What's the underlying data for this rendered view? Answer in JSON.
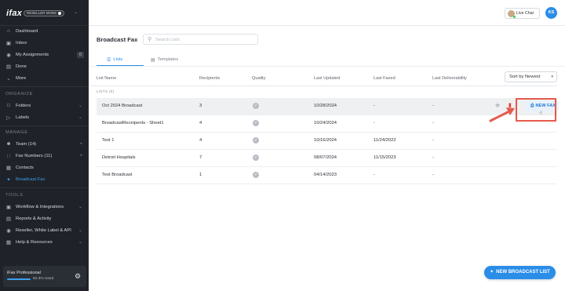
{
  "brand": {
    "logo": "ifax",
    "reseller_label": "RESELLER MODE"
  },
  "sidebar": {
    "primary": [
      {
        "label": "Dashboard",
        "icon": "home-icon"
      },
      {
        "label": "Inbox",
        "icon": "inbox-icon"
      },
      {
        "label": "My Assignments",
        "icon": "assignment-icon",
        "badge": "0"
      },
      {
        "label": "Done",
        "icon": "done-icon"
      },
      {
        "label": "More",
        "icon": "chevron-down-icon"
      }
    ],
    "organize_title": "ORGANIZE",
    "organize": [
      {
        "label": "Folders",
        "icon": "folder-icon"
      },
      {
        "label": "Labels",
        "icon": "label-icon"
      }
    ],
    "manage_title": "MANAGE",
    "manage": [
      {
        "label": "Team (14)",
        "icon": "team-icon"
      },
      {
        "label": "Fax Numbers (11)",
        "icon": "fax-number-icon"
      },
      {
        "label": "Contacts",
        "icon": "contacts-icon"
      },
      {
        "label": "Broadcast Fax",
        "icon": "broadcast-icon",
        "active": true
      }
    ],
    "tools_title": "TOOLS",
    "tools": [
      {
        "label": "Workflow & Integrations",
        "icon": "workflow-icon"
      },
      {
        "label": "Reports & Activity",
        "icon": "reports-icon"
      },
      {
        "label": "Reseller, White Label & API",
        "icon": "globe-icon"
      },
      {
        "label": "Help & Resources",
        "icon": "help-icon"
      }
    ],
    "plan": {
      "name": "iFax Professional",
      "usage": "84.3% Used",
      "usage_fraction": 0.843
    }
  },
  "topbar": {
    "live_chat": "Live Chat",
    "user_initials": "KS"
  },
  "main": {
    "title": "Broadcast Fax",
    "search_placeholder": "Search Lists",
    "tabs": [
      {
        "label": "Lists",
        "active": true
      },
      {
        "label": "Templates",
        "active": false
      }
    ],
    "columns": {
      "name": "List Name",
      "recipients": "Recipients",
      "quality": "Quality",
      "last_updated": "Last Updated",
      "last_faxed": "Last Faxed",
      "last_deliverability": "Last Deliverability"
    },
    "sort_label": "Sort by Newest",
    "lists_count": "LISTS (5)",
    "rows": [
      {
        "name": "Oct 2024 Broadcast",
        "recipients": "3",
        "last_updated": "10/28/2024",
        "last_faxed": "-",
        "last_deliverability": "-"
      },
      {
        "name": "BroadcastReceipents - Sheet1",
        "recipients": "4",
        "last_updated": "10/24/2024",
        "last_faxed": "-",
        "last_deliverability": "-"
      },
      {
        "name": "Test 1",
        "recipients": "4",
        "last_updated": "10/16/2024",
        "last_faxed": "11/24/2022",
        "last_deliverability": "-"
      },
      {
        "name": "Detroit Hospitals",
        "recipients": "7",
        "last_updated": "08/07/2024",
        "last_faxed": "11/15/2023",
        "last_deliverability": "-"
      },
      {
        "name": "Test Broadcast",
        "recipients": "1",
        "last_updated": "04/14/2023",
        "last_faxed": "-",
        "last_deliverability": "-"
      }
    ],
    "new_fax_label": "NEW FAX",
    "new_broadcast_list_label": "NEW BROADCAST LIST"
  },
  "colors": {
    "accent": "#2a8de8",
    "sidebar_bg": "#1f2228",
    "highlight_border": "#e55a4c",
    "delete": "#e53935"
  }
}
